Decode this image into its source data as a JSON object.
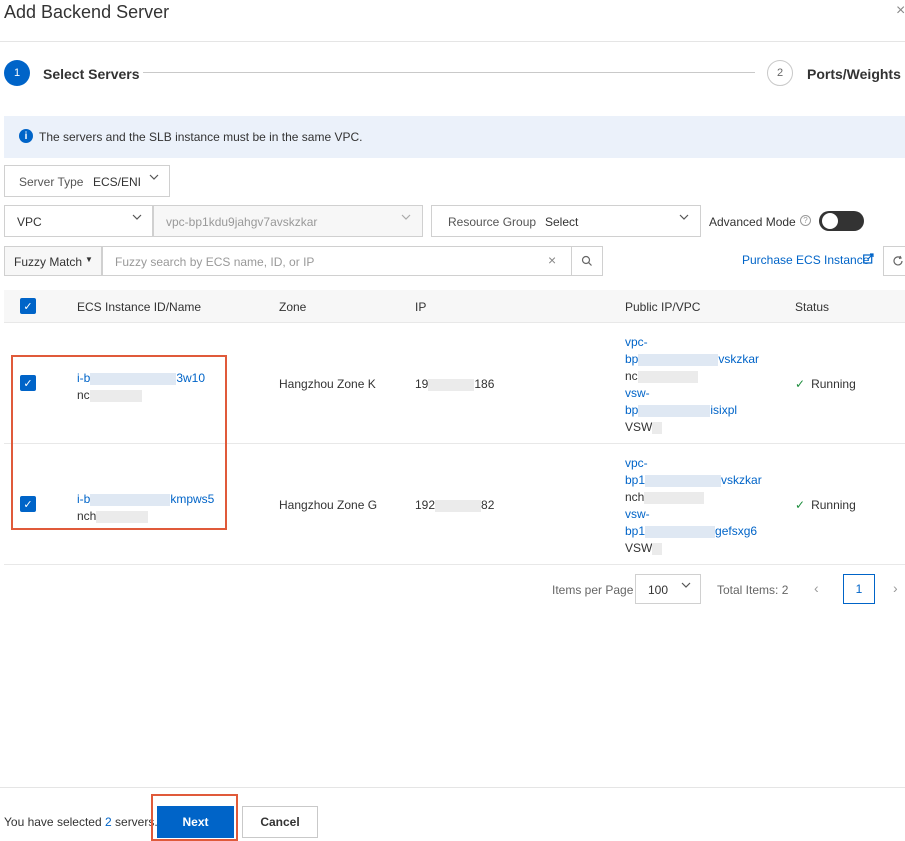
{
  "dialog": {
    "title": "Add Backend Server",
    "close": "×"
  },
  "steps": [
    {
      "number": "1",
      "label": "Select Servers"
    },
    {
      "number": "2",
      "label": "Ports/Weights"
    }
  ],
  "notice": {
    "icon": "i",
    "text": "The servers and the SLB instance must be in the same VPC."
  },
  "filters": {
    "server_type_label": "Server Type",
    "server_type_value": "ECS/ENI",
    "network_label": "VPC",
    "vpc_id": "vpc-bp1kdu9jahgv7avskzkar",
    "resource_group_label": "Resource Group",
    "resource_group_value": "Select",
    "advanced_mode_label": "Advanced Mode",
    "advanced_mode_help": "?"
  },
  "search": {
    "mode": "Fuzzy Match",
    "placeholder": "Fuzzy search by ECS name, ID, or IP",
    "purchase_link": "Purchase ECS Instance"
  },
  "table": {
    "columns": [
      "ECS Instance ID/Name",
      "Zone",
      "IP",
      "Public IP/VPC",
      "Status"
    ],
    "rows": [
      {
        "id_prefix": "i-b",
        "id_suffix": "3w10",
        "name_prefix": "nc",
        "zone": "Hangzhou Zone K",
        "ip_prefix": "19",
        "ip_suffix": "186",
        "vpc_a": "vpc-",
        "vpc_b_prefix": "bp",
        "vpc_b_suffix": "vskzkar",
        "vpc_name_prefix": "nc",
        "vsw_a": "vsw-",
        "vsw_b_prefix": "bp",
        "vsw_b_suffix": "isixpl",
        "vsw_name_prefix": "VSW",
        "status": "Running"
      },
      {
        "id_prefix": "i-b",
        "id_suffix": "kmpws5",
        "name_prefix": "nch",
        "zone": "Hangzhou Zone G",
        "ip_prefix": "192",
        "ip_suffix": "82",
        "vpc_a": "vpc-",
        "vpc_b_prefix": "bp1",
        "vpc_b_suffix": "vskzkar",
        "vpc_name_prefix": "nch",
        "vsw_a": "vsw-",
        "vsw_b_prefix": "bp1",
        "vsw_b_suffix": "gefsxg6",
        "vsw_name_prefix": "VSW",
        "status": "Running"
      }
    ]
  },
  "pagination": {
    "items_per_page_label": "Items per Page",
    "items_per_page": "100",
    "total": "Total Items: 2",
    "current_page": "1"
  },
  "footer": {
    "selected_prefix": "You have selected",
    "selected_count": "2",
    "selected_suffix": "servers.",
    "next": "Next",
    "cancel": "Cancel"
  },
  "colors": {
    "primary": "#0064c8",
    "highlight_box": "#e05a3a",
    "running": "#1e8e3e"
  }
}
